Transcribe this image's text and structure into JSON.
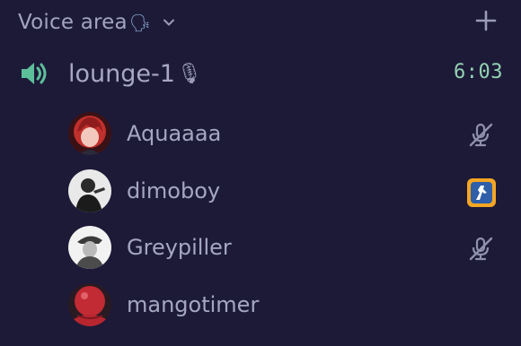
{
  "header": {
    "title": "Voice area",
    "emoji": "🗣"
  },
  "channel": {
    "name": "lounge-1",
    "emoji": "🎙",
    "timer": "6:03"
  },
  "users": [
    {
      "name": "Aquaaaa",
      "status_icon": "mic-muted-icon"
    },
    {
      "name": "dimoboy",
      "status_icon": "game-activity-icon"
    },
    {
      "name": "Greypiller",
      "status_icon": "mic-muted-icon"
    },
    {
      "name": "mangotimer",
      "status_icon": ""
    }
  ],
  "colors": {
    "background": "#1d1a38",
    "text": "#a5a7c0",
    "timer": "#93d2b4",
    "speaker_icon": "#5dbf9a",
    "game_icon_bg": "#f5a623"
  }
}
